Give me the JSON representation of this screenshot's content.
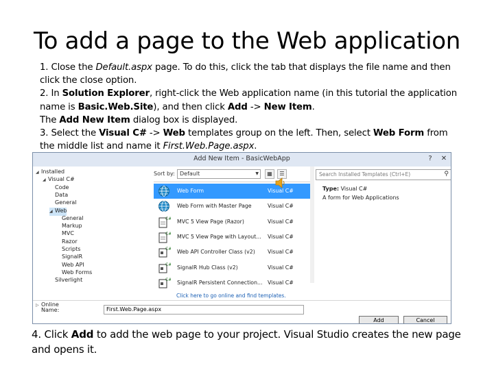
{
  "slide": {
    "title": "To add a page to the Web application",
    "steps": {
      "s1_a": "1. Close the ",
      "s1_b": "Default.aspx",
      "s1_c": " page. To do this, click the tab that displays the file name and then click the close option.",
      "s2_a": "2. In ",
      "s2_b": "Solution Explorer",
      "s2_c": ", right-click the Web application name (in this tutorial the application name is ",
      "s2_d": "Basic.Web.Site",
      "s2_e": "), and then click ",
      "s2_f": "Add",
      "s2_g": " -> ",
      "s2_h": "New Item",
      "s2_i": ".",
      "s2b_a": "The ",
      "s2b_b": "Add New Item",
      "s2b_c": " dialog box is displayed.",
      "s3_a": "3.  Select the ",
      "s3_b": "Visual C#",
      "s3_c": " -> ",
      "s3_d": "Web",
      "s3_e": " templates group on the left. Then, select ",
      "s3_f": "Web Form",
      "s3_g": " from the middle list and name it ",
      "s3_h": "First.Web.Page.aspx",
      "s3_i": "."
    },
    "step4": {
      "a": "4.  Click ",
      "b": "Add",
      "c": " to add the web page to your project. Visual Studio creates the new page and opens it."
    }
  },
  "dialog": {
    "title": "Add New Item - BasicWebApp",
    "help_btn": "?",
    "close_btn": "✕",
    "tree": [
      {
        "label": "Installed",
        "arrow": "◢",
        "indent": 0
      },
      {
        "label": "Visual C#",
        "arrow": "◢",
        "indent": 1
      },
      {
        "label": "Code",
        "arrow": "",
        "indent": 2
      },
      {
        "label": "Data",
        "arrow": "",
        "indent": 2
      },
      {
        "label": "General",
        "arrow": "",
        "indent": 2
      },
      {
        "label": "Web",
        "arrow": "◢",
        "indent": 2
      },
      {
        "label": "General",
        "arrow": "",
        "indent": 3
      },
      {
        "label": "Markup",
        "arrow": "",
        "indent": 3
      },
      {
        "label": "MVC",
        "arrow": "",
        "indent": 3
      },
      {
        "label": "Razor",
        "arrow": "",
        "indent": 3
      },
      {
        "label": "Scripts",
        "arrow": "",
        "indent": 3
      },
      {
        "label": "SignalR",
        "arrow": "",
        "indent": 3
      },
      {
        "label": "Web API",
        "arrow": "",
        "indent": 3
      },
      {
        "label": "Web Forms",
        "arrow": "",
        "indent": 3
      },
      {
        "label": "Silverlight",
        "arrow": "",
        "indent": 2
      },
      {
        "label": "Online",
        "arrow": "▷",
        "indent": 0
      }
    ],
    "sort_label": "Sort by:",
    "sort_value": "Default",
    "templates": [
      {
        "name": "Web Form",
        "lang": "Visual C#",
        "icon": "globe"
      },
      {
        "name": "Web Form with Master Page",
        "lang": "Visual C#",
        "icon": "globe"
      },
      {
        "name": "MVC 5 View Page (Razor)",
        "lang": "Visual C#",
        "icon": "cs-page"
      },
      {
        "name": "MVC 5 View Page with Layout...",
        "lang": "Visual C#",
        "icon": "cs-page"
      },
      {
        "name": "Web API Controller Class (v2)",
        "lang": "Visual C#",
        "icon": "cs-class"
      },
      {
        "name": "SignalR Hub Class (v2)",
        "lang": "Visual C#",
        "icon": "cs-class"
      },
      {
        "name": "SignalR Persistent Connection...",
        "lang": "Visual C#",
        "icon": "cs-class"
      }
    ],
    "online_link": "Click here to go online and find templates.",
    "search_placeholder": "Search Installed Templates (Ctrl+E)",
    "details_type_label": "Type:",
    "details_type_value": "Visual C#",
    "details_desc": "A form for Web Applications",
    "name_label": "Name:",
    "name_value": "First.Web.Page.aspx",
    "add_button": "Add",
    "cancel_button": "Cancel",
    "colors": {
      "selection": "#3399ff",
      "tree_selection": "#cce4f7",
      "link": "#1a5fb4"
    }
  }
}
